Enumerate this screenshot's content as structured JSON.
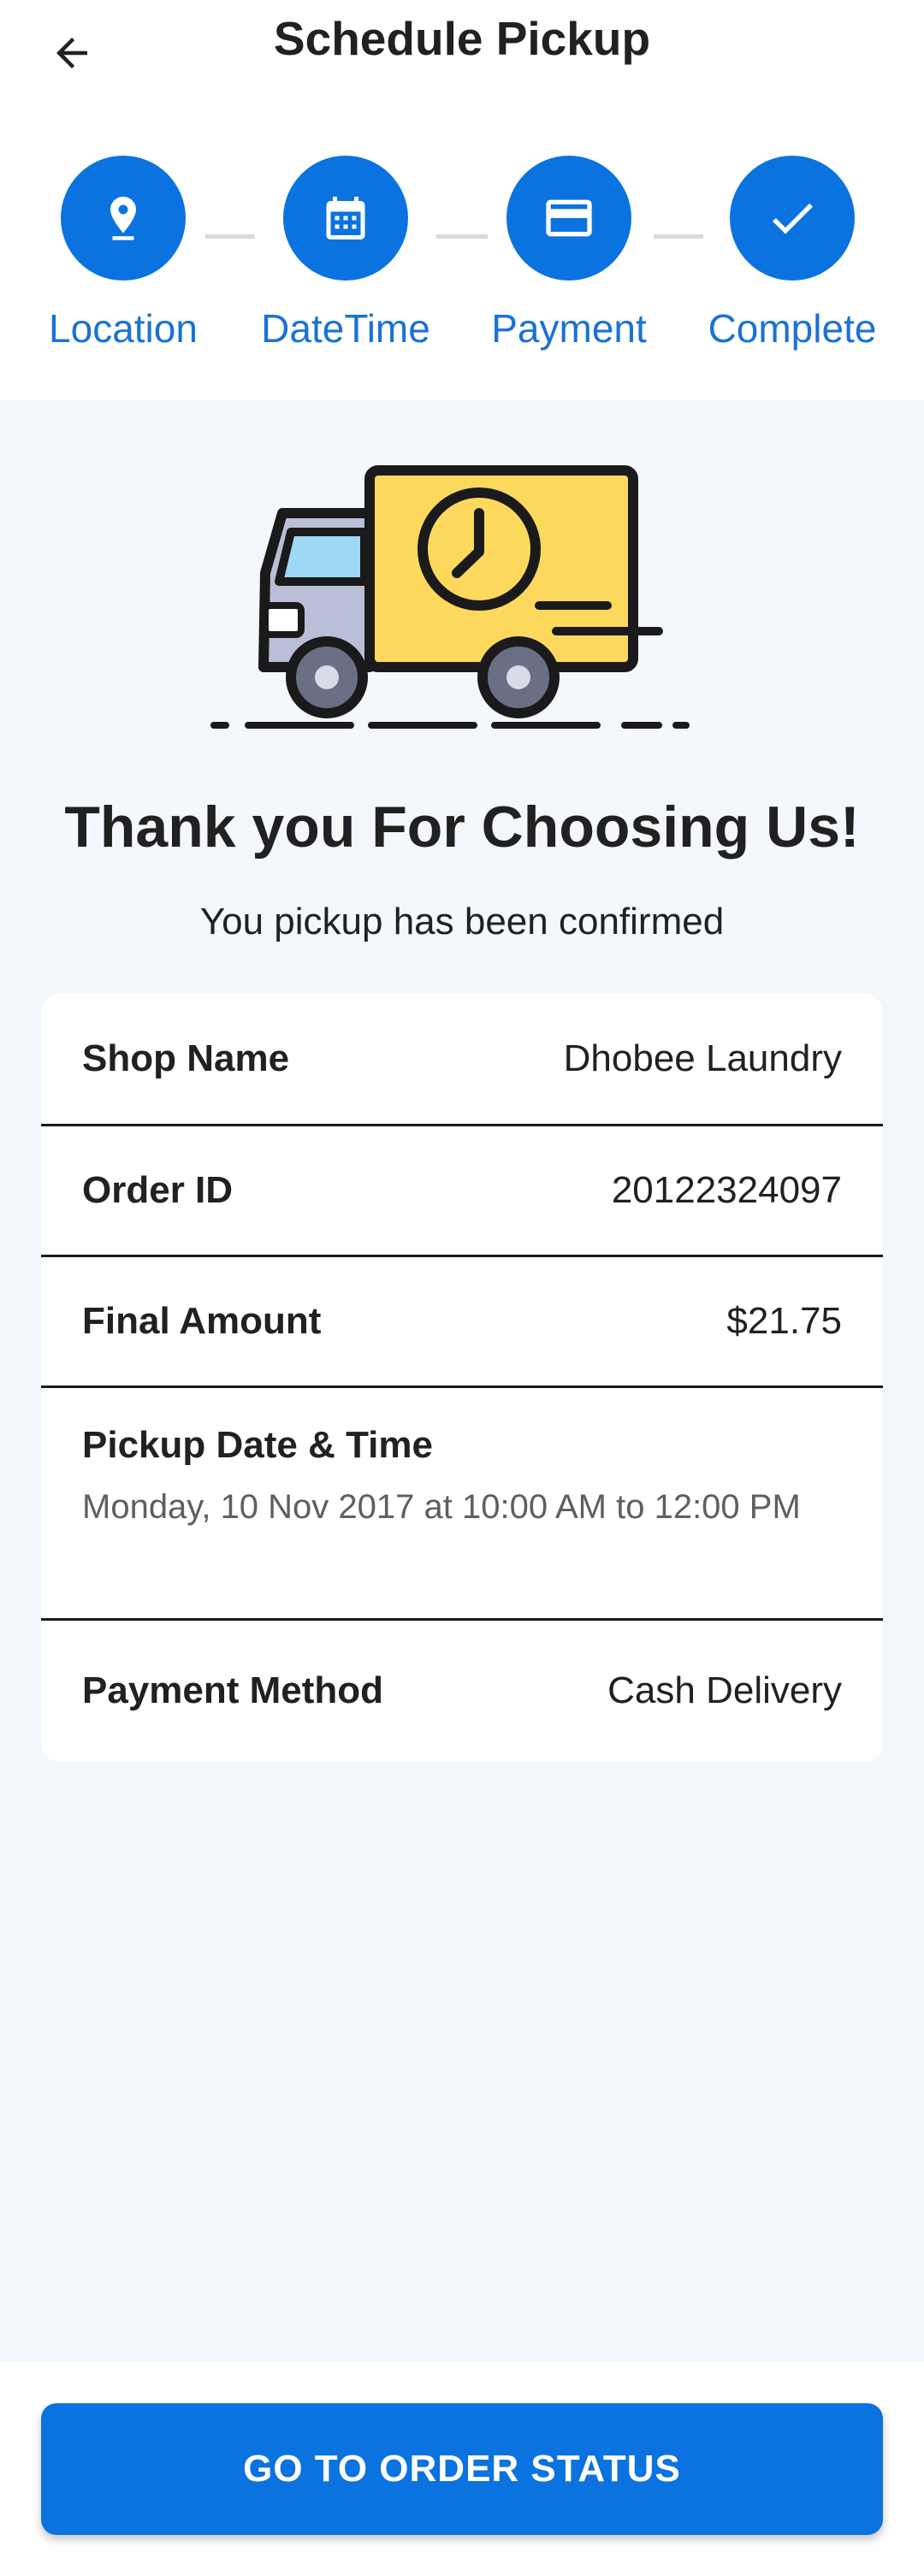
{
  "header": {
    "title": "Schedule Pickup",
    "back_icon": "arrow-left-icon"
  },
  "steps": [
    {
      "label": "Location",
      "icon": "location-pin-icon"
    },
    {
      "label": "DateTime",
      "icon": "calendar-icon"
    },
    {
      "label": "Payment",
      "icon": "credit-card-icon"
    },
    {
      "label": "Complete",
      "icon": "check-icon"
    }
  ],
  "confirmation": {
    "heading": "Thank you For Choosing Us!",
    "subheading": "You pickup has been confirmed",
    "illustration": "delivery-truck-clock-icon"
  },
  "details": {
    "shop_name_label": "Shop Name",
    "shop_name_value": "Dhobee Laundry",
    "order_id_label": "Order ID",
    "order_id_value": "20122324097",
    "final_amount_label": "Final Amount",
    "final_amount_value": "$21.75",
    "pickup_label": "Pickup Date & Time",
    "pickup_value": "Monday, 10 Nov 2017 at 10:00 AM to 12:00 PM",
    "payment_method_label": "Payment Method",
    "payment_method_value": "Cash Delivery"
  },
  "actions": {
    "go_to_order_status": "GO TO ORDER STATUS"
  },
  "colors": {
    "primary": "#0b73e0",
    "step_label": "#1a72d6",
    "background": "#f4f8fc",
    "card": "#ffffff"
  }
}
